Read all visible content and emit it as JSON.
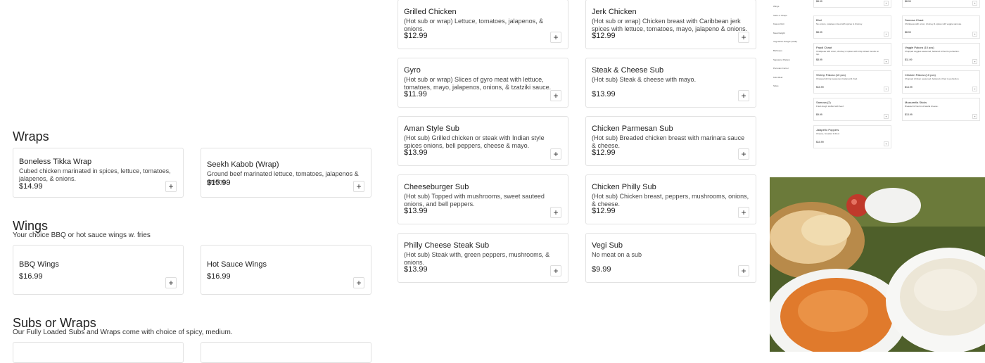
{
  "colors": {
    "accent": "#222222",
    "border": "#e2e2e2",
    "photo_bg": "#5a6b2e"
  },
  "col2": [
    {
      "name": "Grilled Chicken",
      "desc": "(Hot sub or wrap) Lettuce, tomatoes, jalapenos, & onions.",
      "price": "$12.99"
    },
    {
      "name": "Gyro",
      "desc": "(Hot sub or wrap) Slices of gyro meat with lettuce, tomatoes, mayo, jalapenos, onions, & tzatziki sauce.",
      "price": "$11.99"
    },
    {
      "name": "Aman Style Sub",
      "desc": "(Hot sub) Grilled chicken or steak with Indian style spices onions, bell peppers, cheese & mayo.",
      "price": "$13.99"
    },
    {
      "name": "Cheeseburger Sub",
      "desc": "(Hot sub) Topped with mushrooms, sweet sauteed onions, and bell peppers.",
      "price": "$13.99"
    },
    {
      "name": "Philly Cheese Steak Sub",
      "desc": "(Hot sub) Steak with, green peppers, mushrooms, & onions.",
      "price": "$13.99"
    }
  ],
  "col3": [
    {
      "name": "Jerk Chicken",
      "desc": "(Hot sub or wrap) Chicken breast with Caribbean jerk spices with lettuce, tomatoes, mayo, jalapeno & onions.",
      "price": "$12.99"
    },
    {
      "name": "Steak & Cheese Sub",
      "desc": "(Hot sub) Steak & cheese with mayo.",
      "price": "$13.99"
    },
    {
      "name": "Chicken Parmesan Sub",
      "desc": "(Hot sub) Breaded chicken breast with marinara sauce & cheese.",
      "price": "$12.99"
    },
    {
      "name": "Chicken Philly Sub",
      "desc": "(Hot sub) Chicken breast, peppers, mushrooms, onions, & cheese.",
      "price": "$12.99"
    },
    {
      "name": "Vegi Sub",
      "desc": "No meat on a sub",
      "price": "$9.99"
    }
  ],
  "wraps": {
    "title": "Wraps",
    "items": [
      {
        "name": "Boneless Tikka Wrap",
        "desc": "Cubed chicken marinated in spices, lettuce, tomatoes, jalapenos, & onions.",
        "price": "$14.99"
      },
      {
        "name": "Seekh Kabob (Wrap)",
        "desc": "Ground beef marinated lettuce, tomatoes, jalapenos & onions.",
        "price": "$15.99"
      }
    ]
  },
  "wings": {
    "title": "Wings",
    "subtitle": "Your choice BBQ or hot sauce wings w. fries",
    "items": [
      {
        "name": "BBQ Wings",
        "price": "$16.99"
      },
      {
        "name": "Hot Sauce Wings",
        "price": "$16.99"
      }
    ]
  },
  "subs": {
    "title": "Subs or Wraps",
    "subtitle": "Our Fully Loaded Subs and Wraps come with choice of spicy, medium."
  },
  "add_symbol": "+",
  "thumb": {
    "sidebar": [
      "Wings",
      "Subs or Wraps",
      "Kasoor Roti",
      "Meat Delight",
      "Vegetarian Delight (Veah)",
      "Barbeque",
      "Signature Platters",
      "Peruvian Corner",
      "Kids Meal",
      "Sides"
    ],
    "left_items": [
      {
        "name": "",
        "desc": "",
        "price": "$8.99"
      },
      {
        "name": "Bhel",
        "desc": "No onions, potatoes mixed with spices & chutney.",
        "price": "$8.99"
      },
      {
        "name": "Papdi Chaat",
        "desc": "Chickpeas with onion, chutney & spices with crisp wheat rounds on top.",
        "price": "$8.99"
      },
      {
        "name": "Shrimp Pakora (10 pcs)",
        "desc": "Chopped shrimp seasoned, battered & fried.",
        "price": "$10.99"
      },
      {
        "name": "Samosa (2)",
        "desc": "Fried dough stuffed with beef.",
        "price": "$9.99"
      },
      {
        "name": "Jalapeño Poppers",
        "desc": "Cheese, breaded & fried.",
        "price": "$10.99"
      }
    ],
    "right_items": [
      {
        "name": "",
        "desc": "",
        "price": "$8.99"
      },
      {
        "name": "Samosa Chaat",
        "desc": "Chickpeas with onion, chutney & spices with veggie samosa.",
        "price": "$8.99"
      },
      {
        "name": "Veggie Pakora (10 pcs)",
        "desc": "Chopped veggies seasoned, battered & fried to perfection.",
        "price": "$11.99"
      },
      {
        "name": "Chicken Pakora (10 pcs)",
        "desc": "Chopped chicken seasoned, battered & fried to perfection.",
        "price": "$14.99"
      },
      {
        "name": "Mozzarella Sticks",
        "desc": "Breaded & fried mozzarella cheese.",
        "price": "$13.99"
      }
    ]
  }
}
